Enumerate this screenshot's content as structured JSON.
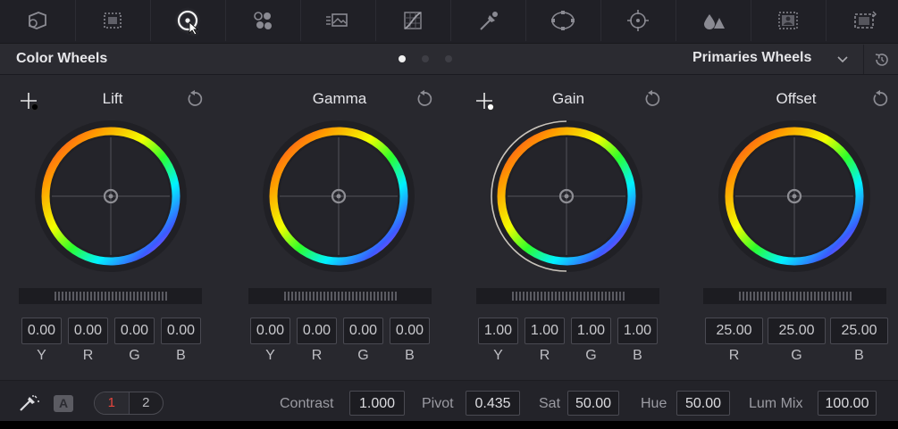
{
  "toolbar": {
    "icons": [
      "camera-raw-icon",
      "color-match-icon",
      "color-wheels-icon",
      "rgb-mixer-icon",
      "motion-effects-icon",
      "curves-icon",
      "qualifier-icon",
      "window-icon",
      "tracker-icon",
      "blur-icon",
      "key-icon",
      "sizing-icon"
    ],
    "active_index": 2
  },
  "header": {
    "title": "Color Wheels",
    "mode": "Primaries Wheels",
    "pages": 3,
    "active_page": 0
  },
  "wheels": [
    {
      "name": "Lift",
      "values": [
        "0.00",
        "0.00",
        "0.00",
        "0.00"
      ],
      "labels": [
        "Y",
        "R",
        "G",
        "B"
      ],
      "has_picker": true,
      "outer_arc": false
    },
    {
      "name": "Gamma",
      "values": [
        "0.00",
        "0.00",
        "0.00",
        "0.00"
      ],
      "labels": [
        "Y",
        "R",
        "G",
        "B"
      ],
      "has_picker": false,
      "outer_arc": false
    },
    {
      "name": "Gain",
      "values": [
        "1.00",
        "1.00",
        "1.00",
        "1.00"
      ],
      "labels": [
        "Y",
        "R",
        "G",
        "B"
      ],
      "has_picker": true,
      "outer_arc": true
    },
    {
      "name": "Offset",
      "values": [
        "25.00",
        "25.00",
        "25.00"
      ],
      "labels": [
        "R",
        "G",
        "B"
      ],
      "has_picker": false,
      "outer_arc": false
    }
  ],
  "bottom": {
    "auto_label": "A",
    "pages": [
      "1",
      "2"
    ],
    "contrast_label": "Contrast",
    "contrast": "1.000",
    "pivot_label": "Pivot",
    "pivot": "0.435",
    "sat_label": "Sat",
    "sat": "50.00",
    "hue_label": "Hue",
    "hue": "50.00",
    "lummix_label": "Lum Mix",
    "lummix": "100.00"
  }
}
